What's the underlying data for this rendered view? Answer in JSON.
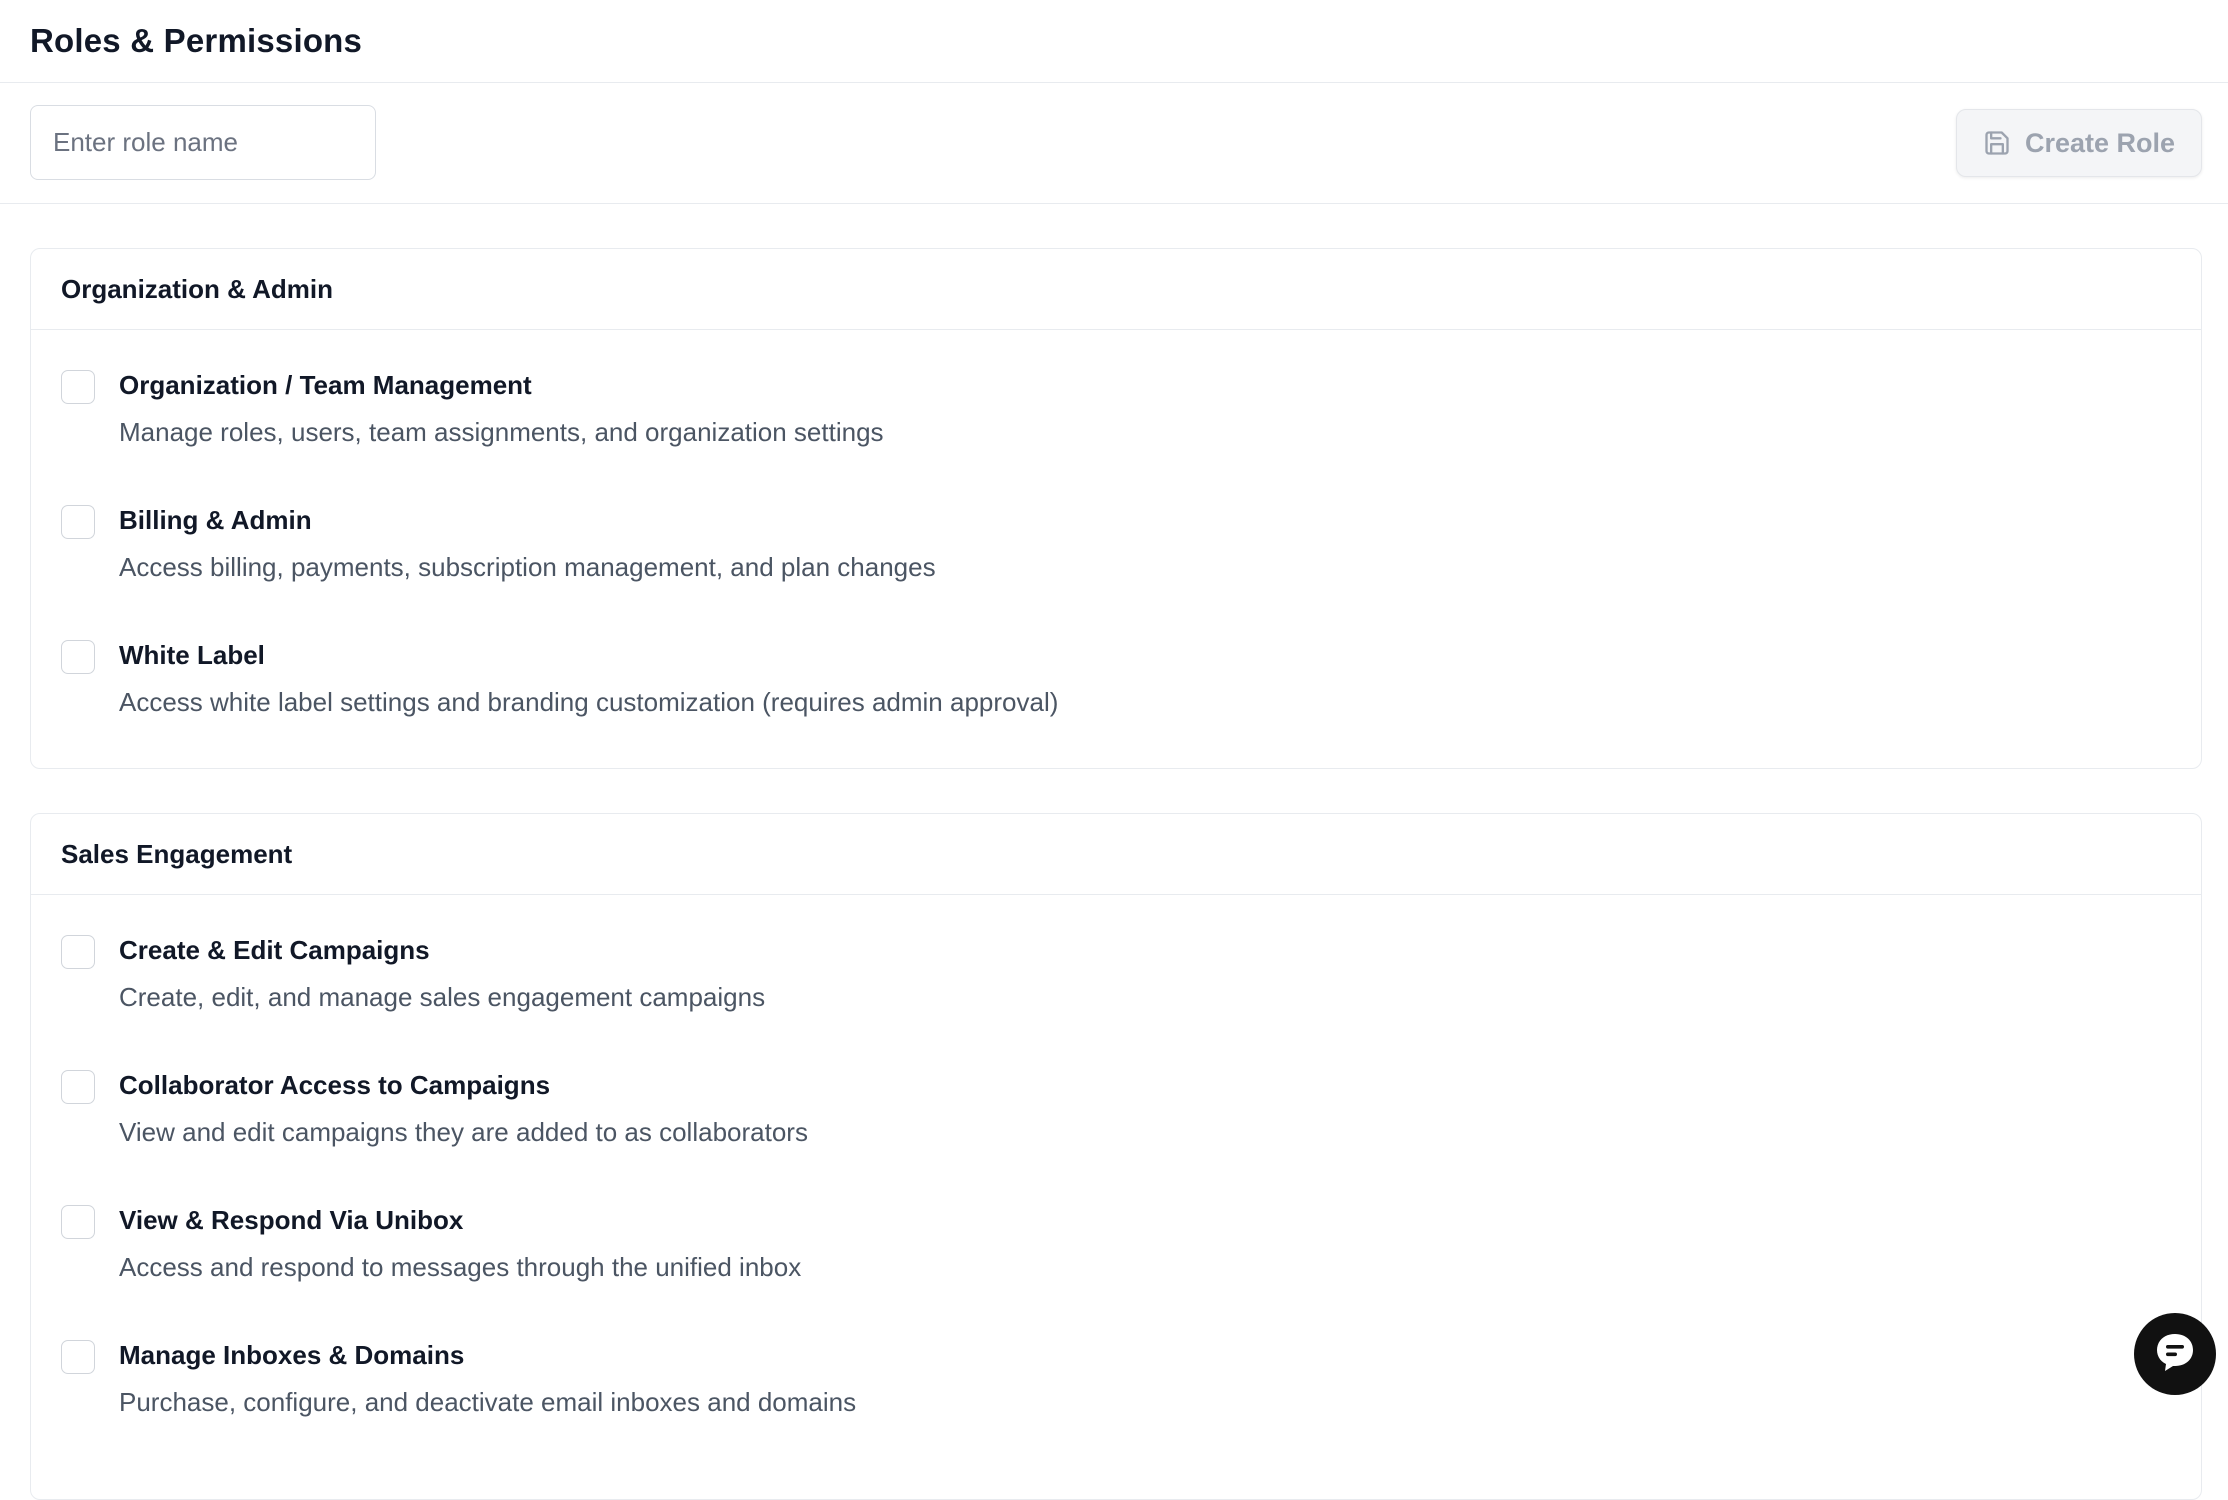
{
  "header": {
    "title": "Roles & Permissions"
  },
  "toolbar": {
    "role_input_placeholder": "Enter role name",
    "role_input_value": "",
    "create_button_label": "Create Role",
    "create_button_icon": "save-icon",
    "create_button_enabled": false
  },
  "sections": [
    {
      "title": "Organization & Admin",
      "permissions": [
        {
          "title": "Organization / Team Management",
          "description": "Manage roles, users, team assignments, and organization settings",
          "checked": false
        },
        {
          "title": "Billing & Admin",
          "description": "Access billing, payments, subscription management, and plan changes",
          "checked": false
        },
        {
          "title": "White Label",
          "description": "Access white label settings and branding customization (requires admin approval)",
          "checked": false
        }
      ]
    },
    {
      "title": "Sales Engagement",
      "permissions": [
        {
          "title": "Create & Edit Campaigns",
          "description": "Create, edit, and manage sales engagement campaigns",
          "checked": false
        },
        {
          "title": "Collaborator Access to Campaigns",
          "description": "View and edit campaigns they are added to as collaborators",
          "checked": false
        },
        {
          "title": "View & Respond Via Unibox",
          "description": "Access and respond to messages through the unified inbox",
          "checked": false
        },
        {
          "title": "Manage Inboxes & Domains",
          "description": "Purchase, configure, and deactivate email inboxes and domains",
          "checked": false
        }
      ]
    }
  ],
  "chat_widget": {
    "icon": "chat-icon",
    "color": "#111111"
  }
}
